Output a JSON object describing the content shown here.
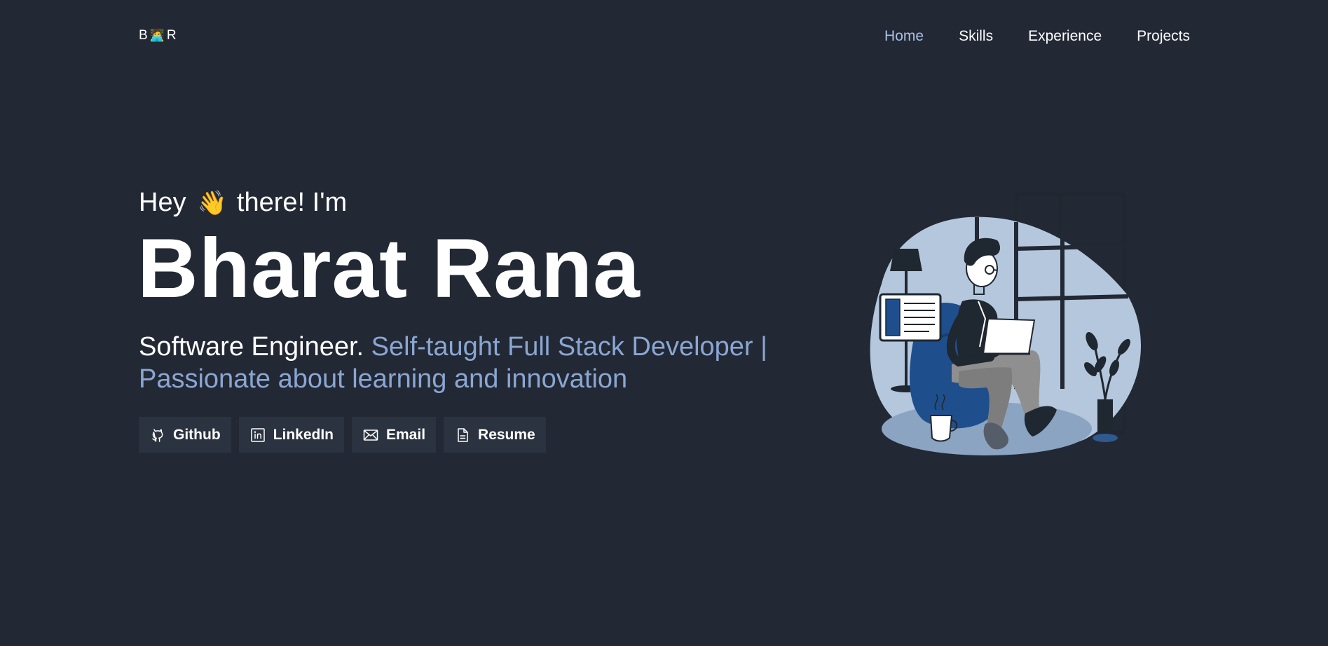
{
  "navbar": {
    "logo": {
      "left": "B",
      "middle": "🧑‍💻",
      "right": "R"
    },
    "links": [
      {
        "label": "Home",
        "active": true
      },
      {
        "label": "Skills",
        "active": false
      },
      {
        "label": "Experience",
        "active": false
      },
      {
        "label": "Projects",
        "active": false
      }
    ]
  },
  "hero": {
    "greeting_before": "Hey",
    "greeting_emoji": "👋",
    "greeting_after": "there! I'm",
    "name": "Bharat Rana",
    "tagline_primary": "Software Engineer.",
    "tagline_accent": "Self-taught Full Stack Developer | Passionate about learning and innovation",
    "buttons": [
      {
        "label": "Github",
        "icon": "github-icon"
      },
      {
        "label": "LinkedIn",
        "icon": "linkedin-icon"
      },
      {
        "label": "Email",
        "icon": "email-icon"
      },
      {
        "label": "Resume",
        "icon": "document-icon"
      }
    ]
  },
  "colors": {
    "background": "#222834",
    "button_background": "#2b3240",
    "text": "#ffffff",
    "accent": "#8aa6d2",
    "nav_active": "#a8c0e4"
  }
}
